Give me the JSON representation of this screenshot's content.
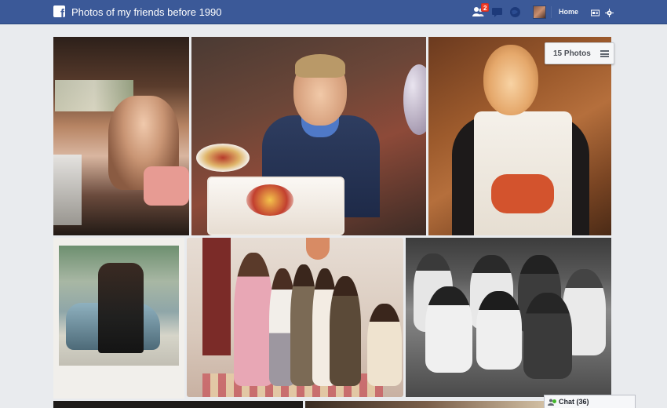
{
  "app": {
    "title": "Photos of my friends before 1990"
  },
  "topbar": {
    "friend_requests_badge": "2",
    "home_label": "Home",
    "icons": [
      "facebook-logo",
      "friend-requests-icon",
      "messages-icon",
      "notifications-icon",
      "account-settings-icon",
      "gear-icon"
    ],
    "colors": {
      "bar": "#3b5998",
      "badge": "#f03d25"
    }
  },
  "album": {
    "photo_count_label": "15 Photos"
  },
  "chat": {
    "label": "Chat (36)"
  }
}
